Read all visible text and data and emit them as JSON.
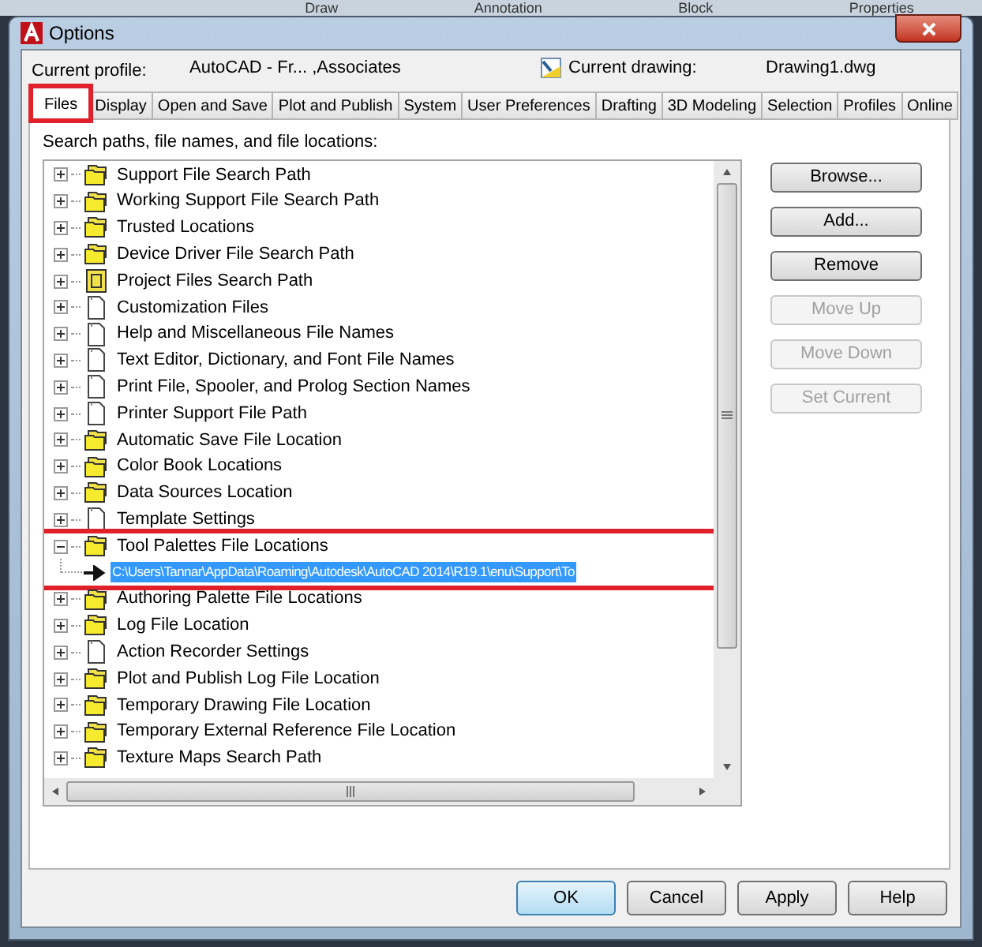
{
  "ribbon": [
    "Draw",
    "Annotation",
    "Block",
    "Properties"
  ],
  "window": {
    "title": "Options"
  },
  "profile": {
    "label": "Current profile:",
    "value": "AutoCAD - Fr... ,Associates"
  },
  "drawing": {
    "label": "Current drawing:",
    "value": "Drawing1.dwg"
  },
  "tabs": [
    {
      "label": "Files",
      "selected": true,
      "highlighted": true
    },
    {
      "label": "Display",
      "selected": false,
      "highlighted": false
    },
    {
      "label": "Open and Save",
      "selected": false,
      "highlighted": false
    },
    {
      "label": "Plot and Publish",
      "selected": false,
      "highlighted": false
    },
    {
      "label": "System",
      "selected": false,
      "highlighted": false
    },
    {
      "label": "User Preferences",
      "selected": false,
      "highlighted": false
    },
    {
      "label": "Drafting",
      "selected": false,
      "highlighted": false
    },
    {
      "label": "3D Modeling",
      "selected": false,
      "highlighted": false
    },
    {
      "label": "Selection",
      "selected": false,
      "highlighted": false
    },
    {
      "label": "Profiles",
      "selected": false,
      "highlighted": false
    },
    {
      "label": "Online",
      "selected": false,
      "highlighted": false
    }
  ],
  "tree_label": "Search paths, file names, and file locations:",
  "tree": [
    {
      "label": "Support File Search Path",
      "kind": "folder",
      "expanded": false
    },
    {
      "label": "Working Support File Search Path",
      "kind": "folder",
      "expanded": false
    },
    {
      "label": "Trusted Locations",
      "kind": "folder",
      "expanded": false
    },
    {
      "label": "Device Driver File Search Path",
      "kind": "folder",
      "expanded": false
    },
    {
      "label": "Project Files Search Path",
      "kind": "project",
      "expanded": false
    },
    {
      "label": "Customization Files",
      "kind": "file",
      "expanded": false
    },
    {
      "label": "Help and Miscellaneous File Names",
      "kind": "file",
      "expanded": false
    },
    {
      "label": "Text Editor, Dictionary, and Font File Names",
      "kind": "file",
      "expanded": false
    },
    {
      "label": "Print File, Spooler, and Prolog Section Names",
      "kind": "file",
      "expanded": false
    },
    {
      "label": "Printer Support File Path",
      "kind": "file",
      "expanded": false
    },
    {
      "label": "Automatic Save File Location",
      "kind": "folder",
      "expanded": false
    },
    {
      "label": "Color Book Locations",
      "kind": "folder",
      "expanded": false
    },
    {
      "label": "Data Sources Location",
      "kind": "folder",
      "expanded": false
    },
    {
      "label": "Template Settings",
      "kind": "file",
      "expanded": false
    },
    {
      "label": "Tool Palettes File Locations",
      "kind": "folder",
      "expanded": true,
      "highlighted": true,
      "children": [
        {
          "label": "C:\\Users\\Tannar\\AppData\\Roaming\\Autodesk\\AutoCAD 2014\\R19.1\\enu\\Support\\To",
          "selected": true
        }
      ]
    },
    {
      "label": "Authoring Palette File Locations",
      "kind": "folder",
      "expanded": false
    },
    {
      "label": "Log File Location",
      "kind": "folder",
      "expanded": false
    },
    {
      "label": "Action Recorder Settings",
      "kind": "file",
      "expanded": false
    },
    {
      "label": "Plot and Publish Log File Location",
      "kind": "folder",
      "expanded": false
    },
    {
      "label": "Temporary Drawing File Location",
      "kind": "folder",
      "expanded": false
    },
    {
      "label": "Temporary External Reference File Location",
      "kind": "folder",
      "expanded": false
    },
    {
      "label": "Texture Maps Search Path",
      "kind": "folder",
      "expanded": false
    }
  ],
  "side_buttons": [
    {
      "label": "Browse...",
      "disabled": false
    },
    {
      "label": "Add...",
      "disabled": false
    },
    {
      "label": "Remove",
      "disabled": false
    },
    {
      "label": "Move Up",
      "disabled": true
    },
    {
      "label": "Move Down",
      "disabled": true
    },
    {
      "label": "Set Current",
      "disabled": true
    }
  ],
  "buttons": [
    {
      "label": "OK",
      "default": true
    },
    {
      "label": "Cancel",
      "default": false
    },
    {
      "label": "Apply",
      "default": false
    },
    {
      "label": "Help",
      "default": false
    }
  ]
}
